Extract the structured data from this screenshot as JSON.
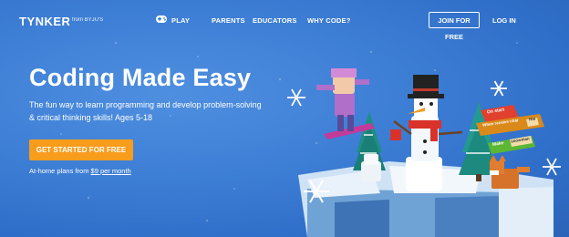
{
  "brand": {
    "logo": "TYNKER",
    "from": "from BYJU'S"
  },
  "nav": {
    "play": "PLAY",
    "parents": "PARENTS",
    "educators": "EDUCATORS",
    "why": "WHY CODE?",
    "join": "JOIN FOR FREE",
    "login": "LOG IN"
  },
  "hero": {
    "title": "Coding Made Easy",
    "subtitle": "The fun way to learn programming and develop problem-solving & critical thinking skills! Ages 5-18",
    "cta": "GET STARTED FOR FREE",
    "plans_prefix": "At-home plans from ",
    "plans_link": "$9 per month"
  },
  "blocks": {
    "on_start": "On start",
    "when_receive": "When receive chat",
    "hat": "Hat",
    "make": "Make",
    "snowman": "snowman"
  },
  "colors": {
    "cta": "#f89c1c",
    "sky": "#3e7fd6",
    "block_red": "#e2402e",
    "block_orange": "#d98a1b",
    "block_green": "#5bb734"
  }
}
